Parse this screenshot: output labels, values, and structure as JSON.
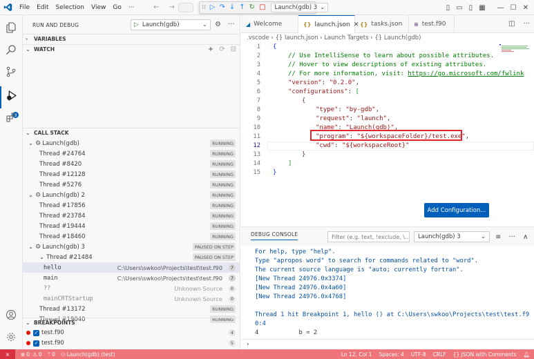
{
  "titlebar": {
    "menu": [
      "File",
      "Edit",
      "Selection",
      "View",
      "Go",
      "···"
    ],
    "debug_config": "Launch(gdb) 3"
  },
  "sidebar": {
    "title": "RUN AND DEBUG",
    "launch_config": "Launch(gdb)",
    "sections": {
      "variables": "VARIABLES",
      "watch": "WATCH",
      "call_stack": "CALL STACK",
      "breakpoints": "BREAKPOINTS"
    },
    "call_stack": [
      {
        "kind": "session",
        "label": "Launch(gdb)",
        "status": "RUNNING"
      },
      {
        "kind": "thread",
        "label": "Thread #24764",
        "status": "RUNNING"
      },
      {
        "kind": "thread",
        "label": "Thread #8420",
        "status": "RUNNING"
      },
      {
        "kind": "thread",
        "label": "Thread #12128",
        "status": "RUNNING"
      },
      {
        "kind": "thread",
        "label": "Thread #5276",
        "status": "RUNNING"
      },
      {
        "kind": "session",
        "label": "Launch(gdb) 2",
        "status": "RUNNING"
      },
      {
        "kind": "thread",
        "label": "Thread #17856",
        "status": "RUNNING"
      },
      {
        "kind": "thread",
        "label": "Thread #23784",
        "status": "RUNNING"
      },
      {
        "kind": "thread",
        "label": "Thread #19444",
        "status": "RUNNING"
      },
      {
        "kind": "thread",
        "label": "Thread #18460",
        "status": "RUNNING"
      },
      {
        "kind": "session",
        "label": "Launch(gdb) 3",
        "status": "PAUSED ON STEP"
      },
      {
        "kind": "thread-open",
        "label": "Thread #21484",
        "status": "PAUSED ON STEP"
      },
      {
        "kind": "frame",
        "label": "hello",
        "path": "C:\\Users\\swkoo\\Projects\\test\\test.f90",
        "line": "7",
        "selected": true
      },
      {
        "kind": "frame",
        "label": "main",
        "path": "C:\\Users\\swkoo\\Projects\\test\\test.f90",
        "line": "7"
      },
      {
        "kind": "frame-dim",
        "label": "??",
        "path": "Unknown Source",
        "line": "0"
      },
      {
        "kind": "frame-dim",
        "label": "mainCRTStartup",
        "path": "Unknown Source",
        "line": "0"
      },
      {
        "kind": "thread",
        "label": "Thread #13172",
        "status": "RUNNING"
      },
      {
        "kind": "thread",
        "label": "Thread #19040",
        "status": "RUNNING"
      }
    ],
    "breakpoints": [
      {
        "file": "test.f90",
        "line": "4"
      },
      {
        "file": "test.f90",
        "line": "5"
      }
    ]
  },
  "editor": {
    "tabs": [
      {
        "label": "Welcome",
        "icon": "vscode-icon"
      },
      {
        "label": "launch.json",
        "icon": "json-icon",
        "active": true
      },
      {
        "label": "tasks.json",
        "icon": "json-icon"
      },
      {
        "label": "test.f90",
        "icon": "fortran-icon"
      }
    ],
    "breadcrumb": [
      ".vscode",
      "{} launch.json",
      "Launch Targets",
      "{} Launch(gdb)"
    ],
    "line_numbers": [
      "1",
      "2",
      "3",
      "4",
      "5",
      "6",
      "7",
      "8",
      "9",
      "10",
      "11",
      "12",
      "13",
      "14",
      "15"
    ],
    "code": {
      "l1": "{",
      "l2": "// Use IntelliSense to learn about possible attributes.",
      "l3": "// Hover to view descriptions of existing attributes.",
      "l4a": "// For more information, visit: ",
      "l4b": "https://go.microsoft.com/fwlink",
      "l5k": "\"version\"",
      "l5v": "\"0.2.0\"",
      "l6k": "\"configurations\"",
      "l7": "{",
      "l8k": "\"type\"",
      "l8v": "\"by-gdb\"",
      "l9k": "\"request\"",
      "l9v": "\"launch\"",
      "l10k": "\"name\"",
      "l10v": "\"Launch(gdb)\"",
      "l11k": "\"program\"",
      "l11v": "\"${workspaceFolder}/test.exe\"",
      "l12k": "\"cwd\"",
      "l12v": "\"${workspaceRoot}\"",
      "l13": "}",
      "l14": "]",
      "l15": "}"
    },
    "add_config_label": "Add Configuration..."
  },
  "panel": {
    "tab": "DEBUG CONSOLE",
    "filter_placeholder": "Filter (e.g. text, !exclude, \\...",
    "session": "Launch(gdb) 3",
    "lines": [
      "For help, type \"help\".",
      "Type \"apropos word\" to search for commands related to \"word\".",
      "The current source language is \"auto; currently fortran\".",
      "[New Thread 24976.0x3374]",
      "[New Thread 24976.0x4a60]",
      "[New Thread 24976.0x4768]",
      "",
      "Thread 1 hit Breakpoint 1, hello () at C:\\Users\\swkoo\\Projects\\test\\test.f9",
      "0:4",
      "4           b = 2"
    ]
  },
  "status": {
    "errors": "0",
    "warnings": "0",
    "ports": "0",
    "debug": "Launch(gdb) (test)",
    "position": "Ln 12, Col 1",
    "spaces": "Spaces: 4",
    "encoding": "UTF-8",
    "eol": "CRLF",
    "language": "{} JSON with Comments",
    "colors": {
      "bar": "#f0757a",
      "remote": "#d9313e",
      "accent": "#005fb8"
    }
  }
}
